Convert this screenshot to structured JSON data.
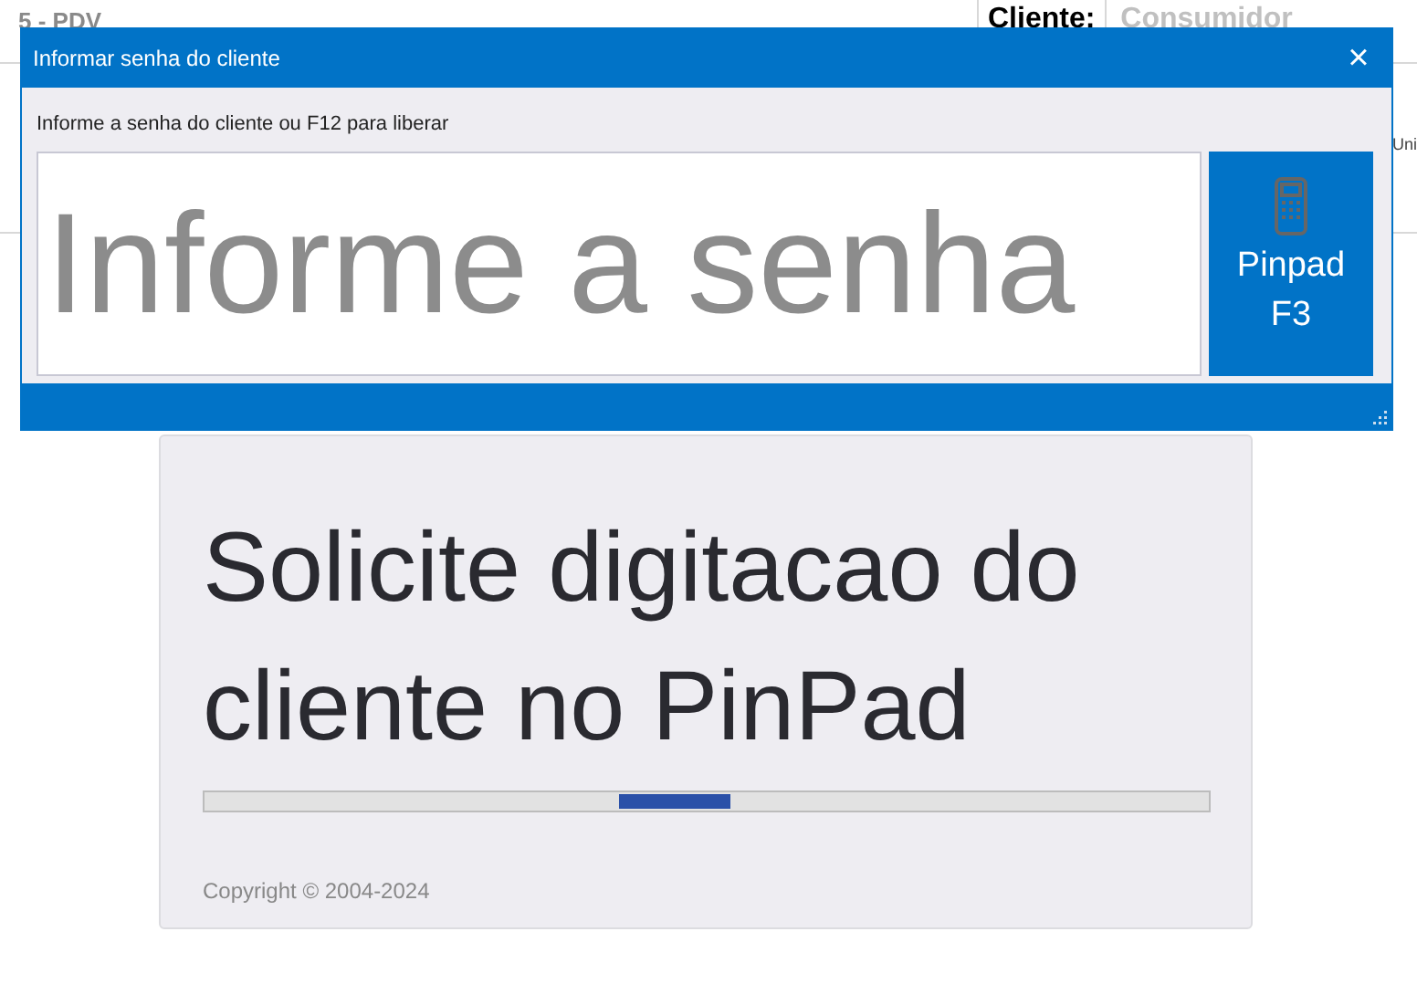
{
  "background": {
    "title": "5 - PDV",
    "client_label": "Cliente:",
    "client_value": "Consumidor",
    "column_cut": "Uni"
  },
  "dialog": {
    "title": "Informar senha do cliente",
    "close": "×",
    "prompt": "Informe a senha do cliente ou F12 para liberar",
    "password_field": {
      "placeholder": "Informe a senha"
    },
    "pinpad_button": {
      "label": "Pinpad",
      "key": "F3"
    }
  },
  "status_card": {
    "message": "Solicite digitacao do cliente no PinPad",
    "copyright": "Copyright © 2004-2024"
  }
}
